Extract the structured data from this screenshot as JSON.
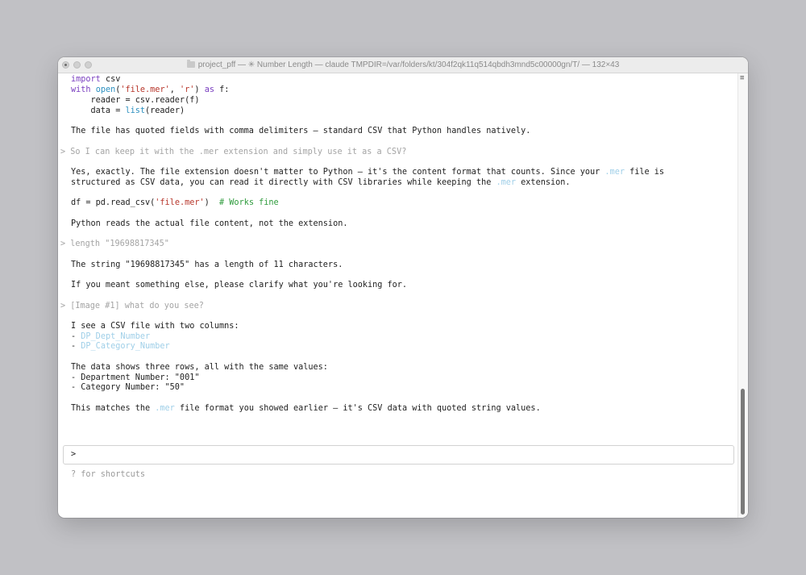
{
  "window": {
    "title": "project_pff — ✳ Number Length — claude TMPDIR=/var/folders/kt/304f2qk11q514qbdh3mnd5c00000gn/T/ — 132×43",
    "colors": {
      "desktop": "#c1c1c5",
      "keyword": "#7a3fc0",
      "function": "#2b8fbf",
      "string": "#b7362b",
      "comment": "#2e9b3c",
      "extension_highlight": "#9fcfe8"
    },
    "scroll_thumb": {
      "start_fraction": 0.71,
      "size_fraction": 0.29
    }
  },
  "transcript": {
    "code1": {
      "l1_kw": "import",
      "l1_rest": " csv",
      "l2_with": "with",
      "l2_open": "open",
      "l2_a": "(",
      "l2_s1": "'file.mer'",
      "l2_b": ", ",
      "l2_s2": "'r'",
      "l2_c": ") ",
      "l2_as": "as",
      "l2_d": " f:",
      "l3": "    reader = csv.reader(f)",
      "l4_a": "    data = ",
      "l4_list": "list",
      "l4_b": "(reader)"
    },
    "note1": "The file has quoted fields with comma delimiters – standard CSV that Python handles natively.",
    "prompt1": "> So I can keep it with the .mer extension and simply use it as a CSV?",
    "answer1_a": "Yes, exactly. The file extension doesn't matter to Python – it's the content format that counts. Since your ",
    "answer1_ext1": ".mer",
    "answer1_b": " file is",
    "answer1_c": "structured as CSV data, you can read it directly with CSV libraries while keeping the ",
    "answer1_ext2": ".mer",
    "answer1_d": " extension.",
    "code2_a": "df = pd.read_csv(",
    "code2_str": "'file.mer'",
    "code2_b": ")  ",
    "code2_comment": "# Works fine",
    "note2": "Python reads the actual file content, not the extension.",
    "prompt2": "> length \"19698817345\"",
    "answer2": "The string \"19698817345\" has a length of 11 characters.",
    "answer2b": "If you meant something else, please clarify what you're looking for.",
    "prompt3": "> [Image #1] what do you see?",
    "answer3": "I see a CSV file with two columns:",
    "col1_dash": "- ",
    "col1": "DP_Dept_Number",
    "col2_dash": "- ",
    "col2": "DP_Category_Number",
    "data_intro": "The data shows three rows, all with the same values:",
    "data1": "- Department Number: \"001\"",
    "data2": "- Category Number: \"50\"",
    "final_a": "This matches the ",
    "final_ext": ".mer",
    "final_b": " file format you showed earlier – it's CSV data with quoted string values."
  },
  "input": {
    "prompt_char": ">",
    "hint": "? for shortcuts"
  }
}
